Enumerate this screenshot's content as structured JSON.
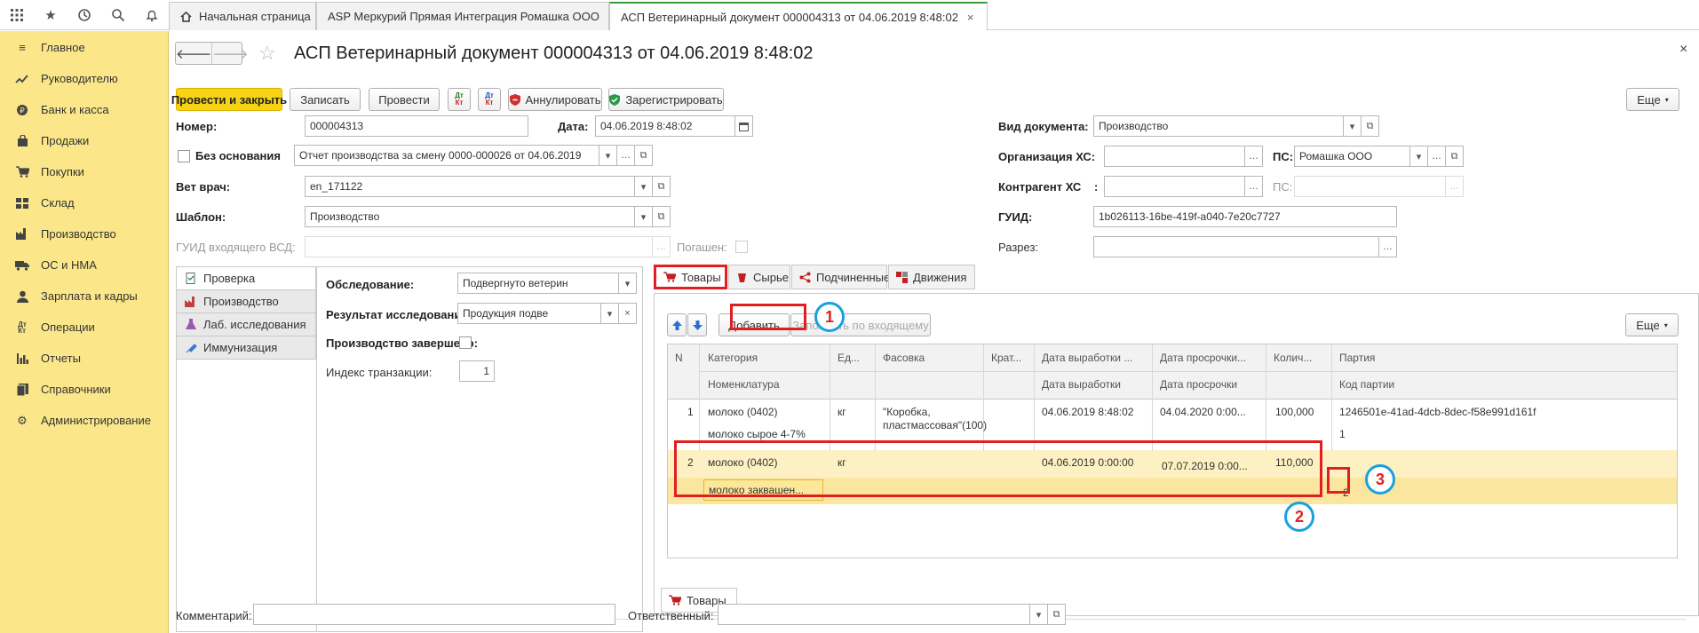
{
  "topbar": {
    "tabs": [
      {
        "label": "Начальная страница",
        "icon": "home-icon"
      },
      {
        "label": "ASP Меркурий Прямая Интеграция Ромашка ООО",
        "close": "×"
      },
      {
        "label": "АСП Ветеринарный документ 000004313 от 04.06.2019 8:48:02",
        "close": "×"
      }
    ]
  },
  "sidebar": {
    "items": [
      {
        "label": "Главное",
        "icon": "menu-lines-icon"
      },
      {
        "label": "Руководителю",
        "icon": "chart-trend-icon"
      },
      {
        "label": "Банк и касса",
        "icon": "ruble-coin-icon"
      },
      {
        "label": "Продажи",
        "icon": "bag-icon"
      },
      {
        "label": "Покупки",
        "icon": "cart-icon"
      },
      {
        "label": "Склад",
        "icon": "grid-icon"
      },
      {
        "label": "Производство",
        "icon": "factory-icon"
      },
      {
        "label": "ОС и НМА",
        "icon": "truck-icon"
      },
      {
        "label": "Зарплата и кадры",
        "icon": "person-icon"
      },
      {
        "label": "Операции",
        "icon": "dt-kt-icon"
      },
      {
        "label": "Отчеты",
        "icon": "bar-chart-icon"
      },
      {
        "label": "Справочники",
        "icon": "book-icon"
      },
      {
        "label": "Администрирование",
        "icon": "gear-icon"
      }
    ]
  },
  "header": {
    "title": "АСП Ветеринарный документ 000004313 от 04.06.2019 8:48:02",
    "close": "×"
  },
  "toolbar": {
    "post_close": "Провести и закрыть",
    "save": "Записать",
    "post": "Провести",
    "annul": "Аннулировать",
    "register": "Зарегистрировать",
    "more": "Еще"
  },
  "form": {
    "number_label": "Номер:",
    "number_value": "000004313",
    "date_label": "Дата:",
    "date_value": "04.06.2019  8:48:02",
    "no_basis_label": "Без основания",
    "basis_value": "Отчет производства за смену 0000-000026 от 04.06.2019",
    "vet_label": "Вет врач:",
    "vet_value": "en_171122",
    "template_label": "Шаблон:",
    "template_value": "Производство",
    "guid_in_label": "ГУИД входящего ВСД:",
    "repaid_label": "Погашен:",
    "doc_type_label": "Вид документа:",
    "doc_type_value": "Производство",
    "org_label": "Организация ХС:",
    "ps_label": "ПС:",
    "ps_value": "Ромашка ООО",
    "contractor_label": "Контрагент ХС",
    "contractor_colon": ":",
    "ps2_label": "ПС:",
    "guid_label": "ГУИД:",
    "guid_value": "1b026113-16be-419f-a040-7e20c7727",
    "razrez_label": "Разрез:"
  },
  "left_panel": {
    "tabs": [
      {
        "label": "Проверка"
      },
      {
        "label": "Производство"
      },
      {
        "label": "Лаб. исследования"
      },
      {
        "label": "Иммунизация"
      }
    ],
    "survey_label": "Обследование:",
    "survey_value": "Подвергнуто ветерин",
    "result_label": "Результат исследования:",
    "result_value": "Продукция подве",
    "done_label": "Производство завершено:",
    "index_label": "Индекс транзакции:",
    "index_value": "1"
  },
  "right_panel": {
    "tabs": [
      {
        "label": "Товары"
      },
      {
        "label": "Сырье"
      },
      {
        "label": "Подчиненные"
      },
      {
        "label": "Движения"
      }
    ],
    "add": "Добавить",
    "fill_incoming": "Заполнить по входящему",
    "more": "Еще",
    "bottom_tab": "Товары",
    "columns": {
      "n": "N",
      "category": "Категория",
      "nomenclature": "Номенклатура",
      "unit": "Ед...",
      "packing": "Фасовка",
      "multiplicity": "Крат...",
      "prod_date": "Дата выработки ...",
      "prod_date2": "Дата выработки",
      "exp_date": "Дата просрочки...",
      "exp_date2": "Дата просрочки",
      "qty": "Колич...",
      "batch": "Партия",
      "batch_code": "Код партии"
    },
    "rows": [
      {
        "n": "1",
        "category": "молоко (0402)",
        "nomenclature": "молоко сырое 4-7%",
        "unit": "кг",
        "packing1": "\"Коробка,",
        "packing2": "пластмассовая\"(100)",
        "prod_date": "04.06.2019 8:48:02",
        "exp_date": "04.04.2020 0:00...",
        "qty": "100,000",
        "batch": "1246501e-41ad-4dcb-8dec-f58e991d161f",
        "batch_code": "1"
      },
      {
        "n": "2",
        "category": "молоко (0402)",
        "nomenclature": "молоко заквашен...",
        "unit": "кг",
        "prod_date": "04.06.2019 0:00:00",
        "exp_date": "07.07.2019 0:00...",
        "qty": "110,000",
        "batch_code": "2"
      }
    ]
  },
  "annotations": {
    "c1": "1",
    "c2": "2",
    "c3": "3"
  },
  "footer": {
    "comment_label": "Комментарий:",
    "responsible_label": "Ответственный:"
  }
}
